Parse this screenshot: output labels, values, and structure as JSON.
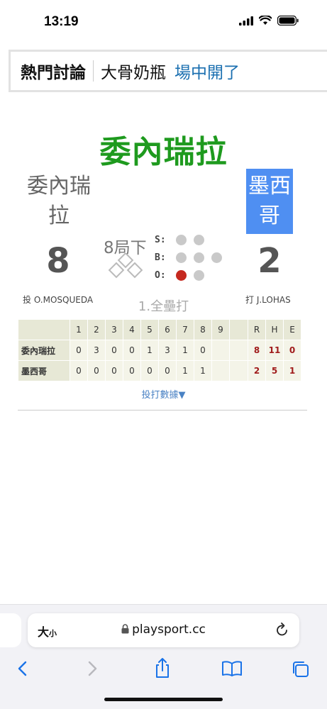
{
  "status": {
    "time": "13:19"
  },
  "nav": {
    "title": "熱門討論",
    "link1": "大骨奶瓶",
    "link2": "場中開了"
  },
  "game": {
    "title": "委內瑞拉",
    "away_team": "委內瑞拉",
    "home_team": "墨西哥",
    "away_score": "8",
    "home_score": "2",
    "inning": "8局下",
    "count": {
      "s_label": "S:",
      "b_label": "B:",
      "o_label": "O:",
      "strikes": 0,
      "balls": 0,
      "outs": 1
    },
    "pitcher": "投 O.MOSQUEDA",
    "batter": "打 J.LOHAS",
    "last_play": "1.全壘打"
  },
  "linescore": {
    "innings": [
      "1",
      "2",
      "3",
      "4",
      "5",
      "6",
      "7",
      "8",
      "9"
    ],
    "totals_headers": [
      "R",
      "H",
      "E"
    ],
    "rows": [
      {
        "team": "委內瑞拉",
        "scores": [
          "0",
          "3",
          "0",
          "0",
          "1",
          "3",
          "1",
          "0",
          ""
        ],
        "totals": [
          "8",
          "11",
          "0"
        ]
      },
      {
        "team": "墨西哥",
        "scores": [
          "0",
          "0",
          "0",
          "0",
          "0",
          "0",
          "1",
          "1",
          ""
        ],
        "totals": [
          "2",
          "5",
          "1"
        ]
      }
    ]
  },
  "pbp_link": "投打數據▼",
  "browser": {
    "text_size": "大",
    "text_size_small": "小",
    "url": "playsport.cc"
  },
  "colors": {
    "title_green": "#1e9a1e",
    "home_highlight": "#4f8ff2",
    "out_red": "#c5291f",
    "link_blue": "#1a6fb0"
  }
}
